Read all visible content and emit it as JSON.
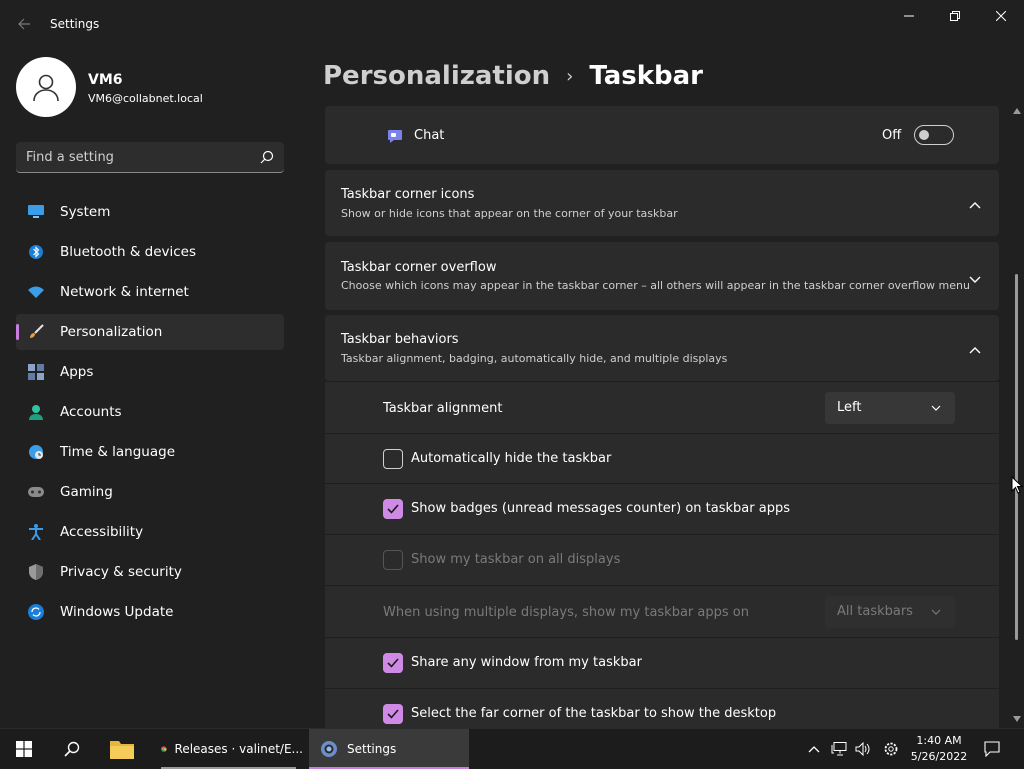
{
  "window": {
    "title": "Settings"
  },
  "profile": {
    "name": "VM6",
    "email": "VM6@collabnet.local"
  },
  "search": {
    "placeholder": "Find a setting"
  },
  "sidebar": {
    "items": [
      {
        "label": "System",
        "icon": "monitor-icon",
        "active": false
      },
      {
        "label": "Bluetooth & devices",
        "icon": "bluetooth-icon",
        "active": false
      },
      {
        "label": "Network & internet",
        "icon": "wifi-icon",
        "active": false
      },
      {
        "label": "Personalization",
        "icon": "brush-icon",
        "active": true
      },
      {
        "label": "Apps",
        "icon": "apps-icon",
        "active": false
      },
      {
        "label": "Accounts",
        "icon": "person-icon",
        "active": false
      },
      {
        "label": "Time & language",
        "icon": "globe-clock-icon",
        "active": false
      },
      {
        "label": "Gaming",
        "icon": "gamepad-icon",
        "active": false
      },
      {
        "label": "Accessibility",
        "icon": "accessibility-icon",
        "active": false
      },
      {
        "label": "Privacy & security",
        "icon": "shield-icon",
        "active": false
      },
      {
        "label": "Windows Update",
        "icon": "update-icon",
        "active": false
      }
    ]
  },
  "breadcrumb": {
    "parent": "Personalization",
    "separator": "›",
    "current": "Taskbar"
  },
  "main": {
    "chat": {
      "label": "Chat",
      "state_label": "Off",
      "on": false
    },
    "corner_icons": {
      "title": "Taskbar corner icons",
      "subtitle": "Show or hide icons that appear on the corner of your taskbar",
      "expanded": true
    },
    "corner_overflow": {
      "title": "Taskbar corner overflow",
      "subtitle": "Choose which icons may appear in the taskbar corner – all others will appear in the taskbar corner overflow menu",
      "expanded": false
    },
    "behaviors": {
      "title": "Taskbar behaviors",
      "subtitle": "Taskbar alignment, badging, automatically hide, and multiple displays",
      "expanded": true,
      "alignment_label": "Taskbar alignment",
      "alignment_value": "Left",
      "auto_hide": {
        "label": "Automatically hide the taskbar",
        "checked": false
      },
      "badges": {
        "label": "Show badges (unread messages counter) on taskbar apps",
        "checked": true
      },
      "all_displays": {
        "label": "Show my taskbar on all displays",
        "checked": false,
        "disabled": true
      },
      "multi_display_label": "When using multiple displays, show my taskbar apps on",
      "multi_display_value": "All taskbars",
      "share_window": {
        "label": "Share any window from my taskbar",
        "checked": true
      },
      "far_corner": {
        "label": "Select the far corner of the taskbar to show the desktop",
        "checked": true
      }
    }
  },
  "taskbar": {
    "apps": [
      {
        "label": "Releases · valinet/E...",
        "icon": "chrome-icon"
      },
      {
        "label": "Settings",
        "icon": "settings-gear-icon",
        "active": true
      }
    ],
    "time": "1:40 AM",
    "date": "5/26/2022"
  },
  "colors": {
    "accent": "#c77de0",
    "background": "#202020",
    "card": "#2b2b2b"
  }
}
